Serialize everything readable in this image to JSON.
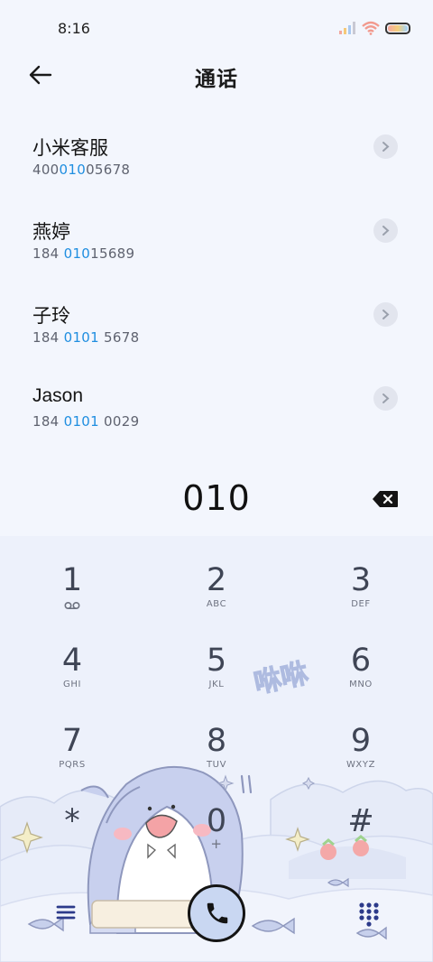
{
  "status": {
    "time": "8:16"
  },
  "header": {
    "title": "通话"
  },
  "contacts": [
    {
      "name": "小米客服",
      "num_pre": "400",
      "num_hl": "010",
      "num_post": "05678"
    },
    {
      "name": "燕婷",
      "num_pre": "184 ",
      "num_hl": "010",
      "num_post": "15689"
    },
    {
      "name": "子玲",
      "num_pre": "184 ",
      "num_hl": "0101",
      "num_post": " 5678"
    },
    {
      "name": "Jason",
      "num_pre": "184 ",
      "num_hl": "0101",
      "num_post": " 0029"
    }
  ],
  "dialer": {
    "input": "010"
  },
  "keypad": [
    {
      "digit": "1",
      "letters": ""
    },
    {
      "digit": "2",
      "letters": "ABC"
    },
    {
      "digit": "3",
      "letters": "DEF"
    },
    {
      "digit": "4",
      "letters": "GHI"
    },
    {
      "digit": "5",
      "letters": "JKL"
    },
    {
      "digit": "6",
      "letters": "MNO"
    },
    {
      "digit": "7",
      "letters": "PQRS"
    },
    {
      "digit": "8",
      "letters": "TUV"
    },
    {
      "digit": "9",
      "letters": "WXYZ"
    },
    {
      "digit": "*",
      "letters": ""
    },
    {
      "digit": "0",
      "letters": "+"
    },
    {
      "digit": "#",
      "letters": ""
    }
  ],
  "wallpaper": {
    "sticker_text": "咻咻"
  },
  "icons": {
    "back": "arrow-left-icon",
    "chevron": "chevron-right-icon",
    "backspace": "backspace-icon",
    "menu": "menu-icon",
    "call": "phone-icon",
    "keypad": "dialpad-icon",
    "voicemail": "voicemail-icon"
  },
  "colors": {
    "highlight": "#1f8ee0",
    "background": "#f3f6fd",
    "call_button": "#c9d7f2"
  }
}
